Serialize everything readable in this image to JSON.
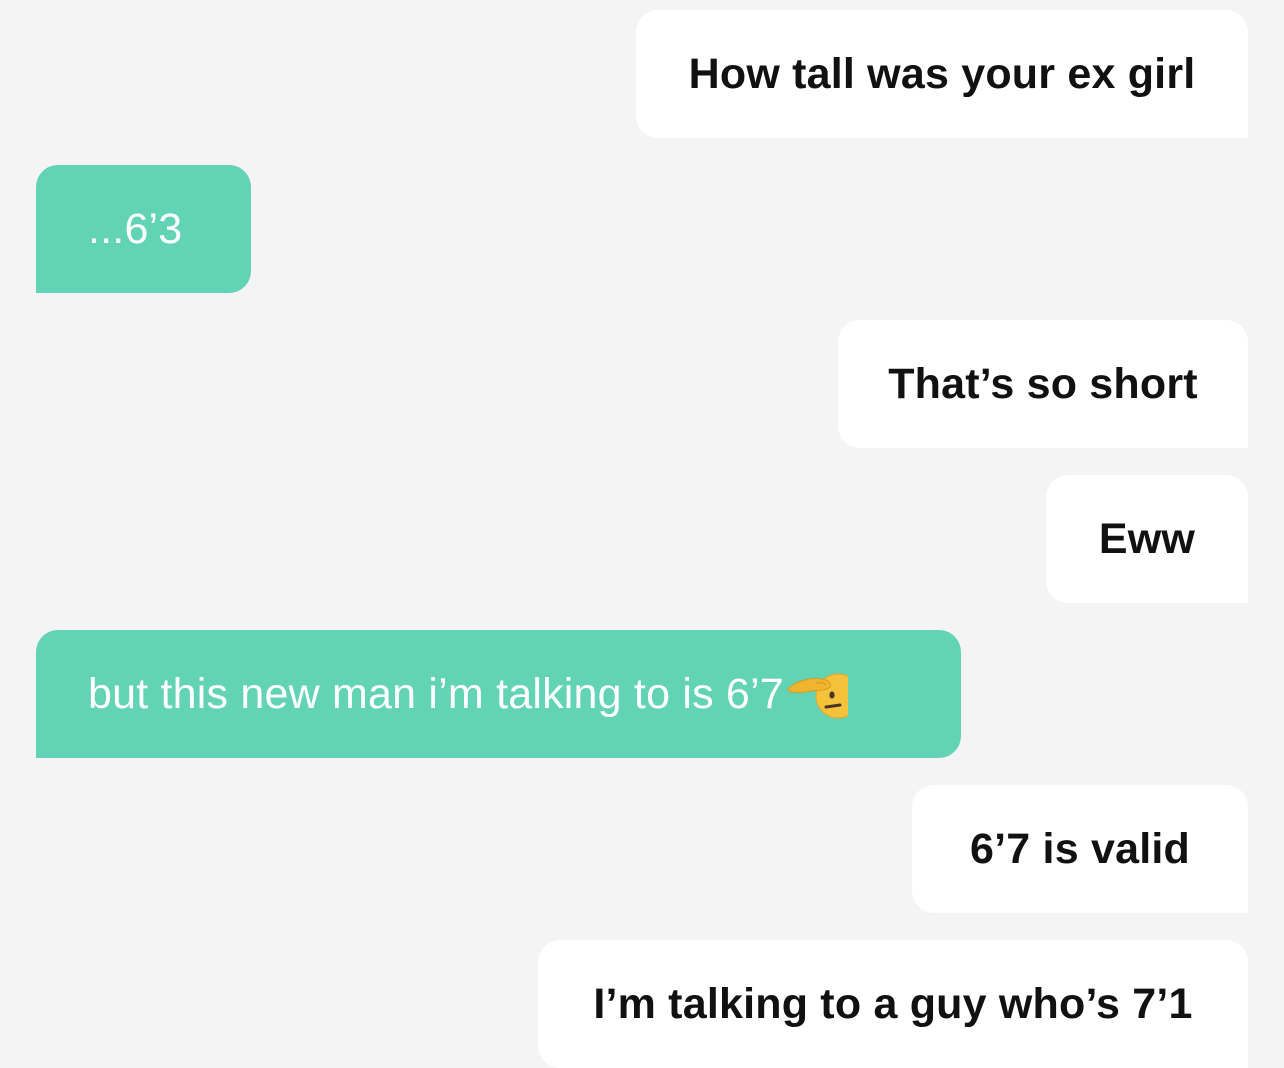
{
  "messages": [
    {
      "sender": "them",
      "text": "How tall was your ex girl"
    },
    {
      "sender": "me",
      "text": "...6’3"
    },
    {
      "sender": "them",
      "text": "That’s so short"
    },
    {
      "sender": "them",
      "text": "Eww"
    },
    {
      "sender": "me",
      "text": "but this new man i’m talking to is 6’7",
      "icon": "saluting-face-emoji"
    },
    {
      "sender": "them",
      "text": "6’7 is valid"
    },
    {
      "sender": "them",
      "text": "I’m talking to a guy who’s 7’1"
    }
  ],
  "colors": {
    "background": "#f4f4f4",
    "incoming_bubble": "#ffffff",
    "outgoing_bubble": "#63d3b6",
    "incoming_text": "#111111",
    "outgoing_text": "#ffffff"
  }
}
